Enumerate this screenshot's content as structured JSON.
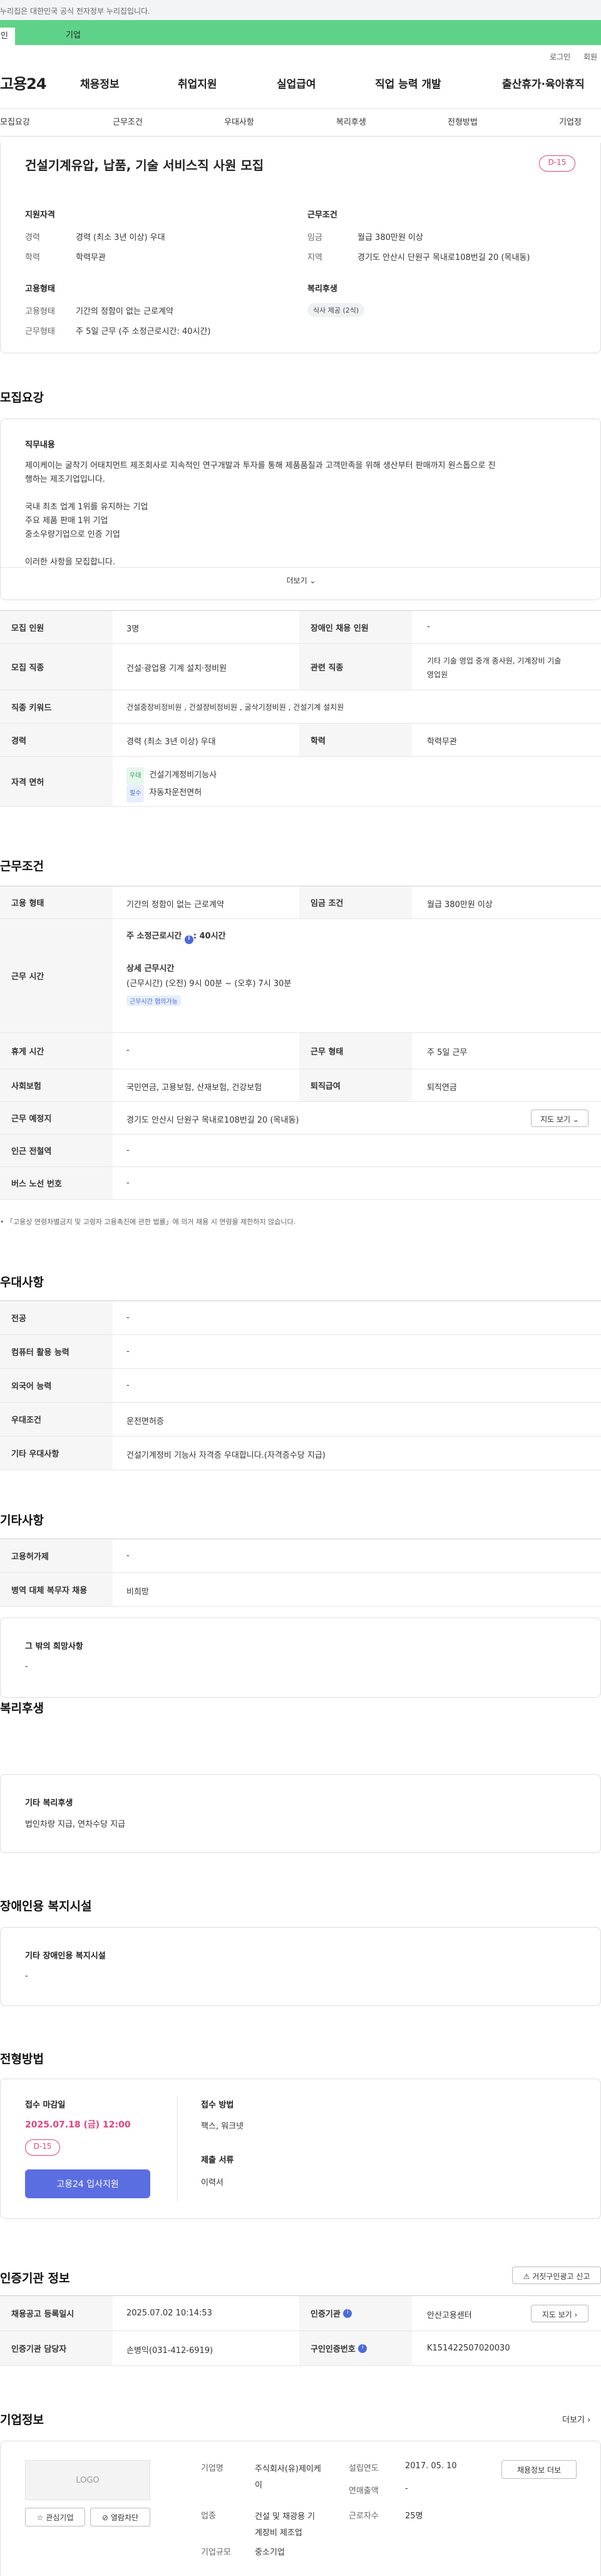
{
  "gov_notice": "누리집은 대한민국 공식 전자정부 누리집입니다.",
  "top_tabs": {
    "individual": "인",
    "business": "기업"
  },
  "util": {
    "login": "로그인",
    "join": "회원"
  },
  "gnb": {
    "logo": "고용24",
    "items": [
      "채용정보",
      "취업지원",
      "실업급여",
      "직업 능력 개발",
      "출산휴가·육아휴직"
    ]
  },
  "tabs": [
    "모집요강",
    "근무조건",
    "우대사항",
    "복리후생",
    "전형방법",
    "기업정"
  ],
  "summary": {
    "title": "건설기계유압, 납품, 기술 서비스직 사원 모집",
    "dday": "D-15",
    "qual_title": "지원자격",
    "career_label": "경력",
    "career_value": "경력 (최소 3년 이상) 우대",
    "edu_label": "학력",
    "edu_value": "학력무관",
    "cond_title": "근무조건",
    "wage_label": "임금",
    "wage_value": "월급 380만원 이상",
    "region_label": "지역",
    "region_value": "경기도 안산시 단원구 목내로108번길 20 (목내동)",
    "emp_title": "고용형태",
    "emp_label": "고용형태",
    "emp_value": "기간의 정함이 없는 근로계약",
    "work_label": "근무형태",
    "work_value": "주 5일 근무 (주 소정근로시간: 40시간)",
    "welfare_title": "복리후생",
    "welfare_chip": "식사 제공 (2식)"
  },
  "recruit": {
    "heading": "모집요강",
    "duty_title": "직무내용",
    "duty_lines": [
      "제이케이는 굴착기 어태치먼트 제조회사로 지속적인 연구개발과 투자를 통해 제품품질과 고객만족을 위해 생산부터 판매까지 원스톱으로 진",
      "행하는 제조기업입니다.",
      "",
      "국내 최초 업계 1위를 유지하는 기업",
      "주요 제품 판매 1위 기업",
      "중소우량기업으로 인증 기업",
      "",
      "이러한 사항을 모집합니다."
    ],
    "more": "더보기",
    "rows": {
      "count_label": "모집 인원",
      "count_value": "3명",
      "disabled_label": "장애인 채용 인원",
      "disabled_value": "-",
      "job_label": "모집 직종",
      "job_value": "건설·광업용 기계 설치·정비원",
      "related_label": "관련 직종",
      "related_value_1": "기타 기술 영업 중개 종사원, 기계장비 기술",
      "related_value_2": "영업원",
      "keyword_label": "직종 키워드",
      "keyword_value": "건설중장비정비원 , 건설장비정비원 , 굴삭기정비원 , 건설기계 설치원",
      "career_label": "경력",
      "career_value": "경력 (최소 3년 이상) 우대",
      "edu_label": "학력",
      "edu_value": "학력무관",
      "license_label": "자격 면허",
      "licenses": [
        {
          "tag": "우대",
          "name": "건설기계정비기능사"
        },
        {
          "tag": "필수",
          "name": "자동차운전면허"
        }
      ]
    }
  },
  "work": {
    "heading": "근무조건",
    "emp_label": "고용 형태",
    "emp_value": "기간의 정함이 없는 근로계약",
    "wage_label": "임금 조건",
    "wage_value": "월급 380만원 이상",
    "time_label": "근무 시간",
    "time_week": "주 소정근로시간",
    "time_week_value": ": 40시간",
    "time_detail_title": "상세 근무시간",
    "time_detail": "(근무시간) (오전) 9시 00분 ~ (오후) 7시 30분",
    "time_chip": "근무시간 협의가능",
    "rest_label": "휴게 시간",
    "rest_value": "-",
    "shape_label": "근무 형태",
    "shape_value": "주 5일 근무",
    "insurance_label": "사회보험",
    "insurance_value": "국민연금, 고용보험, 산재보험, 건강보험",
    "retire_label": "퇴직급여",
    "retire_value": "퇴직연금",
    "place_label": "근무 예정지",
    "place_value": "경기도 안산시 단원구 목내로108번길 20 (목내동)",
    "map_btn": "지도 보기",
    "station_label": "인근 전철역",
    "station_value": "-",
    "bus_label": "버스 노선 번호",
    "bus_value": "-",
    "note": "「고용상 연령차별금지 및 고령자 고용촉진에 관한 법률」에 의거 채용 시 연령을 제한하지 않습니다."
  },
  "pref": {
    "heading": "우대사항",
    "rows": [
      {
        "label": "전공",
        "value": "-"
      },
      {
        "label": "컴퓨터 활용 능력",
        "value": "-"
      },
      {
        "label": "외국어 능력",
        "value": "-"
      },
      {
        "label": "우대조건",
        "value": "운전면허증"
      },
      {
        "label": "기타 우대사항",
        "value": "건설기계정비 기능사 자격증 우대합니다.(자격증수당 지급)"
      }
    ]
  },
  "etc": {
    "heading": "기타사항",
    "rows": [
      {
        "label": "고용허가제",
        "value": "-"
      },
      {
        "label": "병역 대체 복무자 채용",
        "value": "비희망"
      }
    ],
    "box_title": "그 밖의 희망사항",
    "box_value": "-"
  },
  "benefit": {
    "heading": "복리후생",
    "box_title": "기타 복리후생",
    "box_value": "법인차량 지급, 연차수당 지급"
  },
  "facility": {
    "heading": "장애인용 복지시설",
    "box_title": "기타 장애인용 복지시설",
    "box_value": "-"
  },
  "process": {
    "heading": "전형방법",
    "deadline_title": "접수 마감일",
    "deadline": "2025.07.18 (금) 12:00",
    "dday": "D-15",
    "apply_btn": "고용24 입사지원",
    "method_title": "접수 방법",
    "method_value": "팩스, 워크넷",
    "docs_title": "제출 서류",
    "docs_value": "이력서"
  },
  "cert": {
    "heading": "인증기관 정보",
    "report_btn": "거짓구인광고 신고",
    "reg_label": "채용공고 등록일시",
    "reg_value": "2025.07.02 10:14:53",
    "org_label": "인증기관",
    "org_value": "안산고용센터",
    "map_btn": "지도 보기",
    "manager_label": "인증기관 담당자",
    "manager_value": "손병익(031-412-6919)",
    "num_label": "구인인증번호",
    "num_value": "K151422507020030"
  },
  "company": {
    "heading": "기업정보",
    "more": "더보기",
    "logo": "LOGO",
    "fav_btn": "관심기업",
    "block_btn": "열람차단",
    "name_label": "기업명",
    "name_value_1": "주식회사(유)제이케",
    "name_value_2": "이",
    "founded_label": "설립연도",
    "founded_value": "2017. 05. 10",
    "sales_label": "연매출액",
    "sales_value": "-",
    "industry_label": "업종",
    "industry_value_1": "건설 및 채광용 기",
    "industry_value_2": "계장비 제조업",
    "staff_label": "근로자수",
    "staff_value": "25명",
    "size_label": "기업규모",
    "size_value": "중소기업",
    "recruit_btn": "채용정보 더보"
  }
}
